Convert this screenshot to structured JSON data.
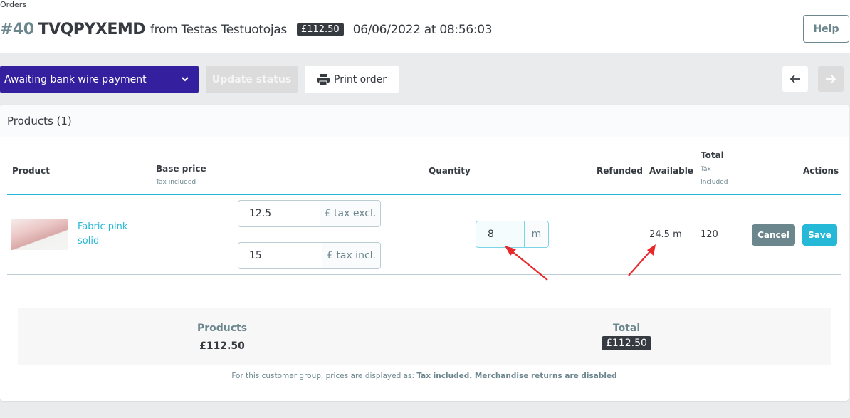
{
  "header": {
    "breadcrumb": "Orders",
    "order_number": "#40",
    "order_reference": "TVQPYXEMD",
    "customer_text": "from Testas Testuotojas",
    "order_total_badge": "£112.50",
    "date_text": "06/06/2022 at 08:56:03",
    "help_label": "Help"
  },
  "toolbar": {
    "status_selected": "Awaiting bank wire payment",
    "update_status_label": "Update status",
    "print_order_label": "Print order",
    "icons": {
      "status_dropdown": "chevron-down-icon",
      "print": "printer-icon",
      "prev": "arrow-left-icon",
      "next": "arrow-right-icon"
    }
  },
  "products": {
    "title": "Products (1)",
    "columns": {
      "product": "Product",
      "base_price": "Base price",
      "base_price_sub": "Tax included",
      "quantity": "Quantity",
      "refunded": "Refunded",
      "available": "Available",
      "total": "Total",
      "total_sub_1": "Tax",
      "total_sub_2": "Included",
      "actions": "Actions"
    },
    "rows": [
      {
        "name": "Fabric pink solid",
        "price_tax_excl": "12.5",
        "price_tax_excl_addon": "£ tax excl.",
        "price_tax_incl": "15",
        "price_tax_incl_addon": "£ tax incl.",
        "quantity": "8",
        "quantity_unit": "m",
        "refunded": "",
        "available": "24.5 m",
        "total": "120",
        "cancel_label": "Cancel",
        "save_label": "Save"
      }
    ]
  },
  "summary": {
    "products_label": "Products",
    "products_value": "£112.50",
    "total_label": "Total",
    "total_value": "£112.50",
    "footnote_prefix": "For this customer group, prices are displayed as: ",
    "footnote_bold": "Tax included. Merchandise returns are disabled"
  },
  "colors": {
    "status_select": "#34209e",
    "accent": "#25b9d7",
    "secondary": "#6c868e",
    "dark_badge": "#363a41",
    "annotation_arrow": "#e8282b"
  }
}
